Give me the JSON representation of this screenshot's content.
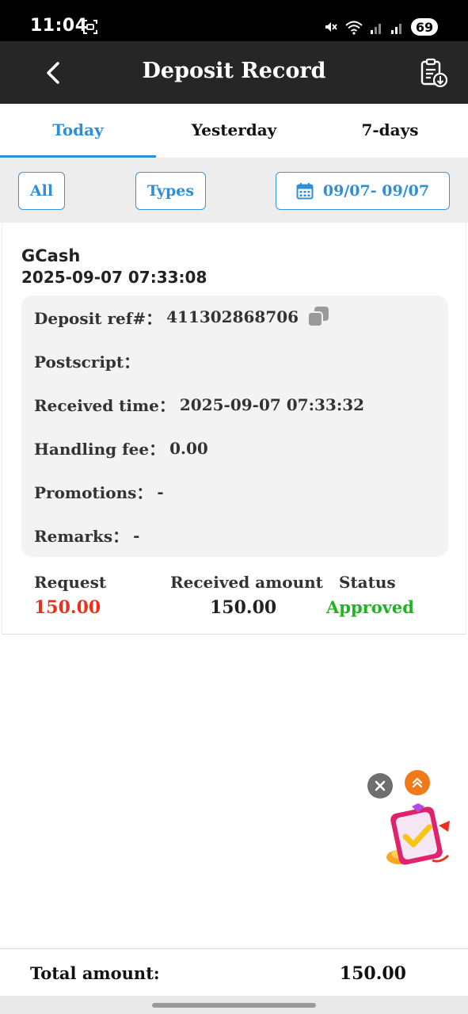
{
  "status_bar": {
    "time": "11:04",
    "battery": "69"
  },
  "header": {
    "title": "Deposit Record"
  },
  "tabs": [
    {
      "label": "Today",
      "active": true
    },
    {
      "label": "Yesterday",
      "active": false
    },
    {
      "label": "7-days",
      "active": false
    }
  ],
  "filters": {
    "all_label": "All",
    "types_label": "Types",
    "date_range": "09/07- 09/07"
  },
  "record": {
    "method": "GCash",
    "datetime": "2025-09-07 07:33:08",
    "details": {
      "ref_label": "Deposit ref#：",
      "ref_value": "411302868706",
      "postscript_label": "Postscript：",
      "postscript_value": "",
      "received_time_label": "Received time：",
      "received_time_value": "2025-09-07 07:33:32",
      "fee_label": "Handling fee：",
      "fee_value": "0.00",
      "promotions_label": "Promotions：",
      "promotions_value": "-",
      "remarks_label": "Remarks：",
      "remarks_value": "-"
    },
    "summary": {
      "request_label": "Request",
      "request_value": "150.00",
      "received_label": "Received amount",
      "received_value": "150.00",
      "status_label": "Status",
      "status_value": "Approved"
    }
  },
  "footer": {
    "total_label": "Total amount:",
    "total_value": "150.00"
  },
  "colors": {
    "accent": "#2f8fd6",
    "request": "#e8321e",
    "approved": "#22b322",
    "header_bg": "#262626"
  }
}
